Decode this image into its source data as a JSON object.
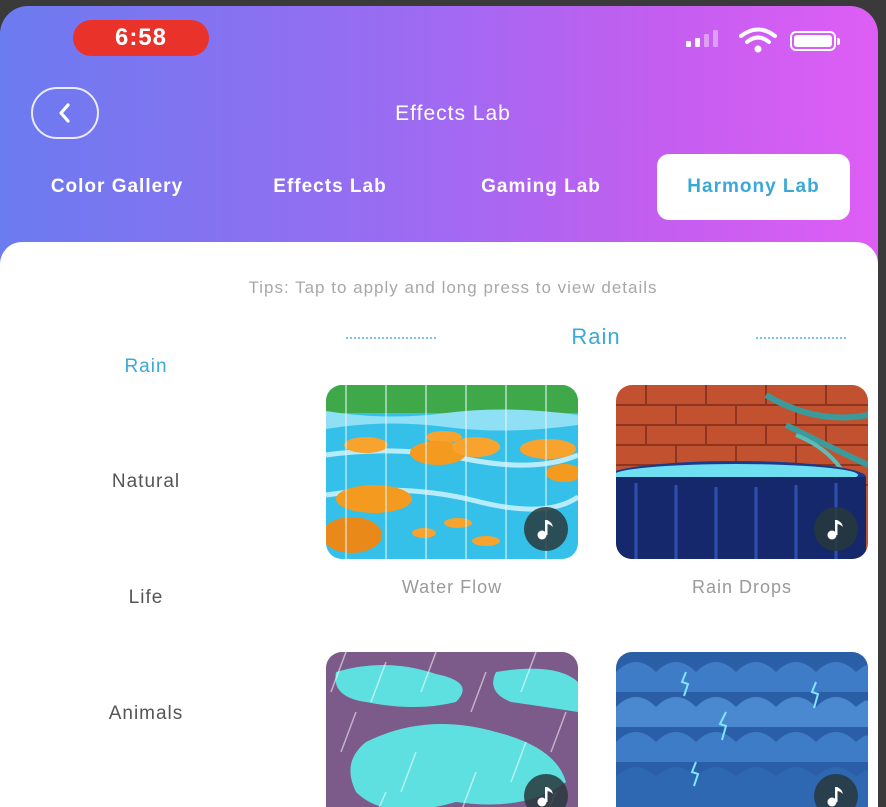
{
  "status_bar": {
    "time": "6:58"
  },
  "header": {
    "title": "Effects Lab"
  },
  "tabs": [
    {
      "label": "Color Gallery"
    },
    {
      "label": "Effects Lab"
    },
    {
      "label": "Gaming Lab"
    },
    {
      "label": "Harmony Lab",
      "active": true
    }
  ],
  "tips": "Tips: Tap to apply and long press to view details",
  "sidebar": {
    "items": [
      {
        "label": "Rain",
        "active": true
      },
      {
        "label": "Natural"
      },
      {
        "label": "Life"
      },
      {
        "label": "Animals"
      }
    ]
  },
  "section": {
    "title": "Rain"
  },
  "cards": [
    {
      "label": "Water Flow"
    },
    {
      "label": "Rain Drops"
    },
    {
      "label": ""
    },
    {
      "label": ""
    }
  ],
  "colors": {
    "accent": "#3aa9d8",
    "gradient_start": "#6b7bf0",
    "gradient_end": "#de5ef5",
    "time_pill": "#e8322a"
  },
  "icons": [
    "back-chevron-icon",
    "signal-icon",
    "wifi-icon",
    "battery-icon",
    "music-note-icon"
  ]
}
